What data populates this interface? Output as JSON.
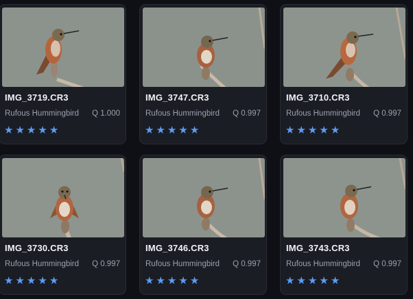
{
  "cards": [
    {
      "filename": "IMG_3719.CR3",
      "species": "Rufous Hummingbird",
      "quality": "Q 1.000",
      "rating": 5,
      "thumbnail_icon": "hummingbird-photo"
    },
    {
      "filename": "IMG_3747.CR3",
      "species": "Rufous Hummingbird",
      "quality": "Q 0.997",
      "rating": 5,
      "thumbnail_icon": "hummingbird-photo"
    },
    {
      "filename": "IMG_3710.CR3",
      "species": "Rufous Hummingbird",
      "quality": "Q 0.997",
      "rating": 5,
      "thumbnail_icon": "hummingbird-photo"
    },
    {
      "filename": "IMG_3730.CR3",
      "species": "Rufous Hummingbird",
      "quality": "Q 0.997",
      "rating": 5,
      "thumbnail_icon": "hummingbird-photo"
    },
    {
      "filename": "IMG_3746.CR3",
      "species": "Rufous Hummingbird",
      "quality": "Q 0.997",
      "rating": 5,
      "thumbnail_icon": "hummingbird-photo"
    },
    {
      "filename": "IMG_3743.CR3",
      "species": "Rufous Hummingbird",
      "quality": "Q 0.997",
      "rating": 5,
      "thumbnail_icon": "hummingbird-photo"
    }
  ],
  "colors": {
    "background": "#0f1015",
    "card": "#1b1d24",
    "star": "#5b9cf6",
    "title": "#f2f3f7",
    "meta": "#9aa0ac"
  }
}
